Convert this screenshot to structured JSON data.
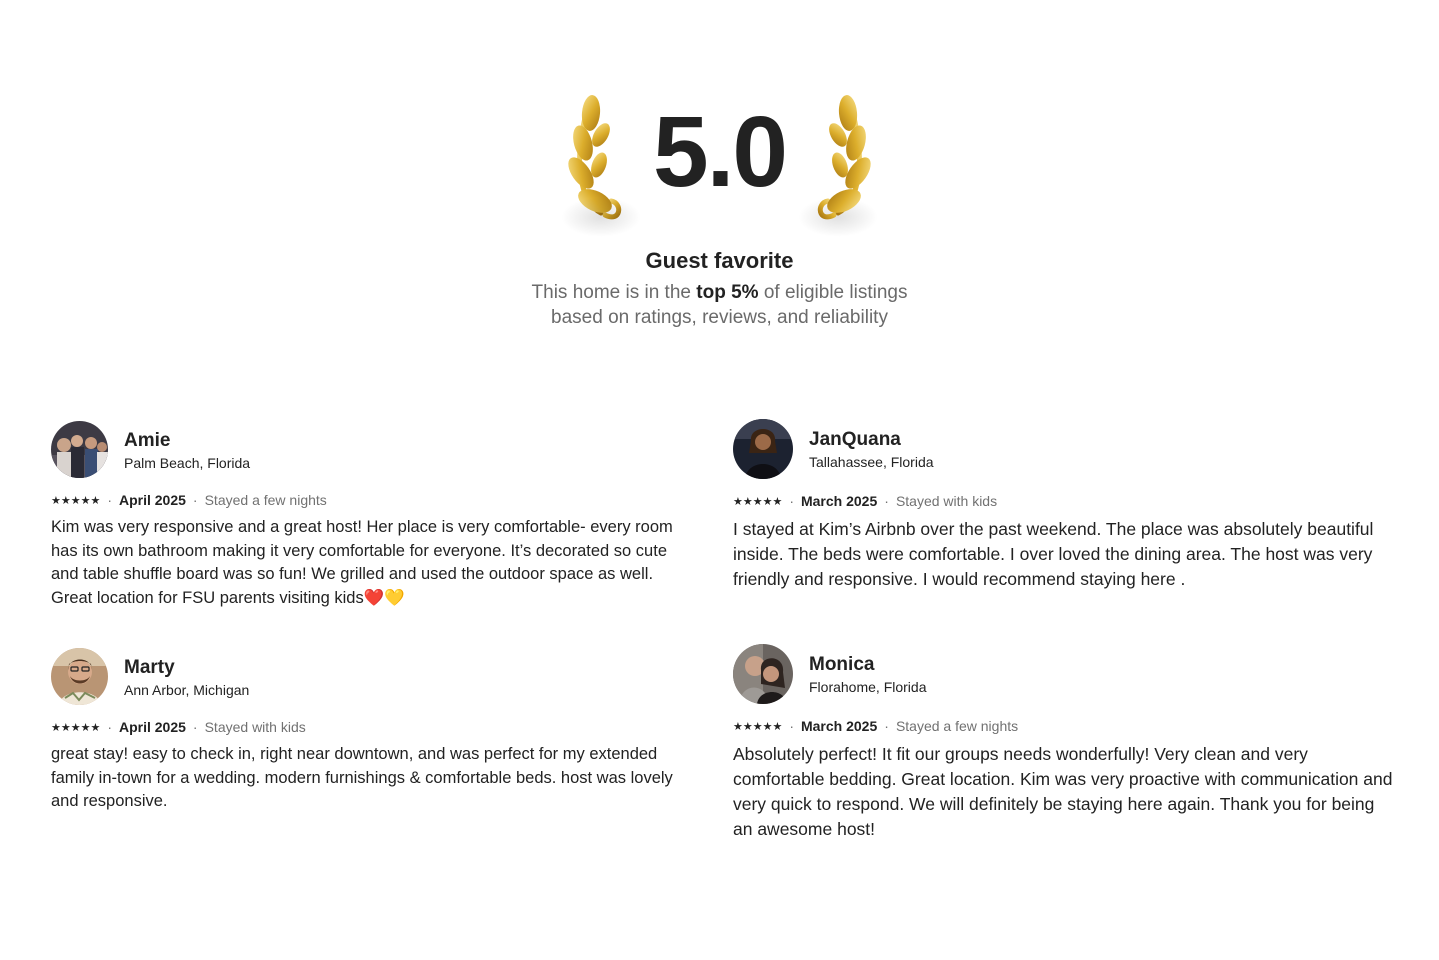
{
  "hero": {
    "rating": "5.0",
    "title": "Guest favorite",
    "subtitle_pre": "This home is in the ",
    "subtitle_bold": "top 5%",
    "subtitle_post": " of eligible listings based on ratings, reviews, and reliability"
  },
  "colors": {
    "gold": "#d9a520",
    "text": "#222222",
    "muted": "#717171"
  },
  "reviews": [
    {
      "name": "Amie",
      "location": "Palm Beach, Florida",
      "stars": "★★★★★",
      "date": "April 2025",
      "stay": "Stayed a few nights",
      "text": "Kim was very responsive and a great host! Her place is very comfortable- every room has its own bathroom making it very comfortable for everyone. It’s decorated so cute and table shuffle board was so fun! We grilled and used the outdoor space as well. Great location for FSU parents visiting kids❤️💛"
    },
    {
      "name": "JanQuana",
      "location": "Tallahassee, Florida",
      "stars": "★★★★★",
      "date": "March 2025",
      "stay": "Stayed with kids",
      "text": "I stayed at Kim’s Airbnb over the past weekend. The place was absolutely beautiful inside. The beds were comfortable. I over loved the dining area. The host was very friendly and responsive. I would recommend staying here ."
    },
    {
      "name": "Marty",
      "location": "Ann Arbor, Michigan",
      "stars": "★★★★★",
      "date": "April 2025",
      "stay": "Stayed with kids",
      "text": "great stay! easy to check in, right near downtown, and was perfect for my extended family in-town for a wedding. modern furnishings & comfortable beds. host was lovely and responsive."
    },
    {
      "name": "Monica",
      "location": "Florahome, Florida",
      "stars": "★★★★★",
      "date": "March 2025",
      "stay": "Stayed a few nights",
      "text": "Absolutely perfect! It fit our groups needs wonderfully! Very clean and very comfortable bedding. Great location. Kim was very proactive with communication and very quick to respond. We will definitely be staying here again. Thank you for being an awesome host!"
    }
  ],
  "separator": "·"
}
